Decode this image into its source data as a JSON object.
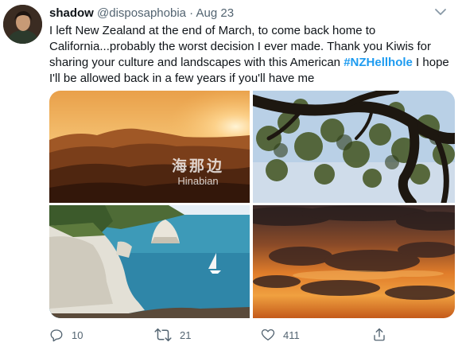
{
  "tweet": {
    "name": "shadow",
    "handle": "@disposaphobia",
    "separator": "·",
    "date": "Aug 23",
    "text_part1": "I left New Zealand at the end of March, to come back home to California...probably the worst decision I ever made. Thank you Kiwis for sharing your culture and landscapes with this American ",
    "hashtag": "#NZHellhole",
    "text_part2": " I hope I'll be allowed back in a few years if you'll have me"
  },
  "media": {
    "watermark_cn": "海那边",
    "watermark_en": "Hinabian",
    "images": [
      {
        "name": "sunset-hills-photo"
      },
      {
        "name": "tree-branches-photo"
      },
      {
        "name": "coastal-cliffs-photo"
      },
      {
        "name": "cloudy-sunset-photo"
      }
    ]
  },
  "actions": {
    "reply_count": "10",
    "retweet_count": "21",
    "like_count": "411",
    "icons": [
      "reply-icon",
      "retweet-icon",
      "like-icon",
      "share-icon"
    ]
  },
  "colors": {
    "text": "#0f1419",
    "secondary": "#536471",
    "hashtag": "#1d9bf0"
  }
}
